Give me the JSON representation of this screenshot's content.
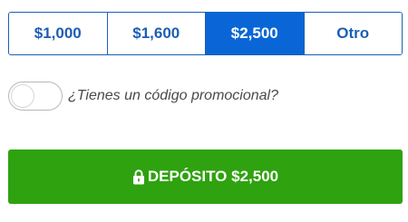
{
  "amounts": [
    {
      "label": "$1,000",
      "selected": false
    },
    {
      "label": "$1,600",
      "selected": false
    },
    {
      "label": "$2,500",
      "selected": true
    },
    {
      "label": "Otro",
      "selected": false
    }
  ],
  "promo": {
    "label": "¿Tienes un código promocional?",
    "toggle_on": false
  },
  "deposit": {
    "label": "DEPÓSITO $2,500",
    "icon": "lock-icon"
  },
  "colors": {
    "accent_blue": "#0a66d6",
    "border_blue": "#1d5fb3",
    "deposit_green": "#2ea20f"
  }
}
